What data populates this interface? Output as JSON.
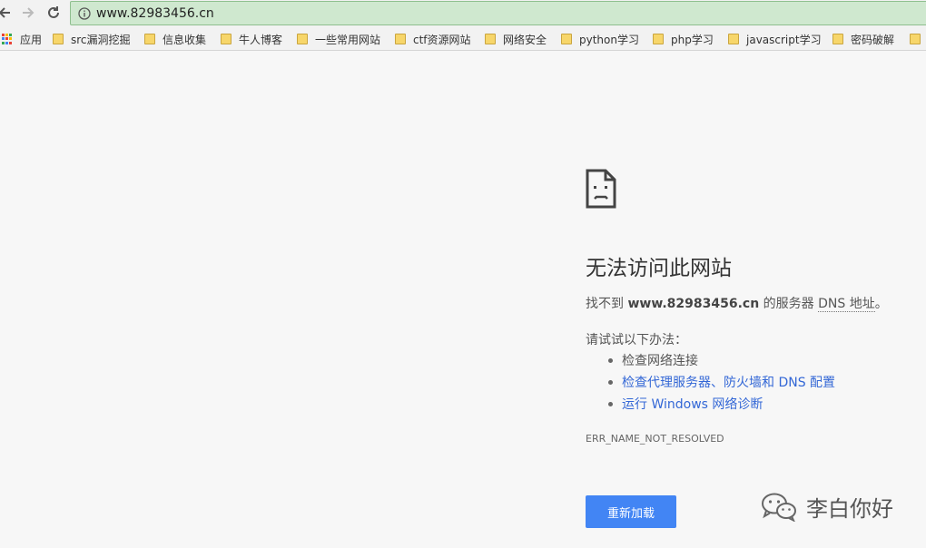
{
  "browser": {
    "url": "www.82983456.cn"
  },
  "bookmarks": {
    "items": [
      {
        "label": "应用",
        "icon": "apps-grid-icon"
      },
      {
        "label": "src漏洞挖掘",
        "icon": "folder-icon"
      },
      {
        "label": "信息收集",
        "icon": "folder-icon"
      },
      {
        "label": "牛人博客",
        "icon": "folder-icon"
      },
      {
        "label": "一些常用网站",
        "icon": "folder-icon"
      },
      {
        "label": "ctf资源网站",
        "icon": "folder-icon"
      },
      {
        "label": "网络安全",
        "icon": "folder-icon"
      },
      {
        "label": "python学习",
        "icon": "folder-icon"
      },
      {
        "label": "php学习",
        "icon": "folder-icon"
      },
      {
        "label": "javascript学习",
        "icon": "folder-icon"
      },
      {
        "label": "密码破解",
        "icon": "folder-icon"
      }
    ]
  },
  "error_page": {
    "icon": "sad-document-icon",
    "title": "无法访问此网站",
    "desc_prefix": "找不到 ",
    "desc_host": "www.82983456.cn",
    "desc_mid": " 的服务器 ",
    "desc_abbr": "DNS 地址",
    "desc_suffix": "。",
    "try_label": "请试试以下办法：",
    "suggestions": [
      {
        "text": "检查网络连接",
        "link": false
      },
      {
        "text": "检查代理服务器、防火墙和 DNS 配置",
        "link": true
      },
      {
        "text": "运行 Windows 网络诊断",
        "link": true
      }
    ],
    "error_code": "ERR_NAME_NOT_RESOLVED",
    "reload_label": "重新加载",
    "link_color": "#3367d6",
    "button_color": "#4285f4"
  },
  "watermark": {
    "text": "李白你好",
    "icon": "wechat-icon"
  }
}
